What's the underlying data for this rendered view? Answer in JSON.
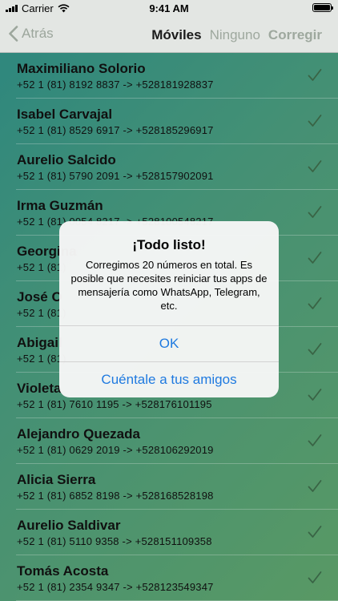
{
  "status": {
    "carrier": "Carrier",
    "time": "9:41 AM"
  },
  "nav": {
    "back_label": "Atrás",
    "tab_active": "Móviles",
    "tab_none": "Ninguno",
    "correct_label": "Corregir"
  },
  "contacts": [
    {
      "name": "Maximiliano Solorio",
      "phones": "+52 1 (81) 8192 8837  ->  +528181928837"
    },
    {
      "name": "Isabel Carvajal",
      "phones": "+52 1 (81) 8529 6917  ->  +528185296917"
    },
    {
      "name": "Aurelio Salcido",
      "phones": "+52 1 (81) 5790 2091  ->  +528157902091"
    },
    {
      "name": "Irma Guzmán",
      "phones": "+52 1 (81) 0054 8217  ->  +528100548217"
    },
    {
      "name": "Georgina",
      "phones": "+52 1 (81)"
    },
    {
      "name": "José O",
      "phones": "+52 1 (81)"
    },
    {
      "name": "Abigail",
      "phones": "+52 1 (81)"
    },
    {
      "name": "Violeta",
      "phones": "+52 1 (81) 7610 1195  ->  +528176101195"
    },
    {
      "name": "Alejandro Quezada",
      "phones": "+52 1 (81) 0629 2019  ->  +528106292019"
    },
    {
      "name": "Alicia Sierra",
      "phones": "+52 1 (81) 6852 8198  ->  +528168528198"
    },
    {
      "name": "Aurelio Saldivar",
      "phones": "+52 1 (81) 5110 9358  ->  +528151109358"
    },
    {
      "name": "Tomás Acosta",
      "phones": "+52 1 (81) 2354 9347  ->  +528123549347"
    }
  ],
  "alert": {
    "title": "¡Todo listo!",
    "message": "Corregimos 20 números en total. Es posible que necesites reiniciar tus apps de mensajería como WhatsApp, Telegram, etc.",
    "ok_label": "OK",
    "share_label": "Cuéntale a tus amigos"
  },
  "colors": {
    "accent": "#1f7ae0",
    "check": "#3d6b4a"
  },
  "icons": {
    "back": "chevron-left-icon",
    "row": "checkmark-icon"
  }
}
